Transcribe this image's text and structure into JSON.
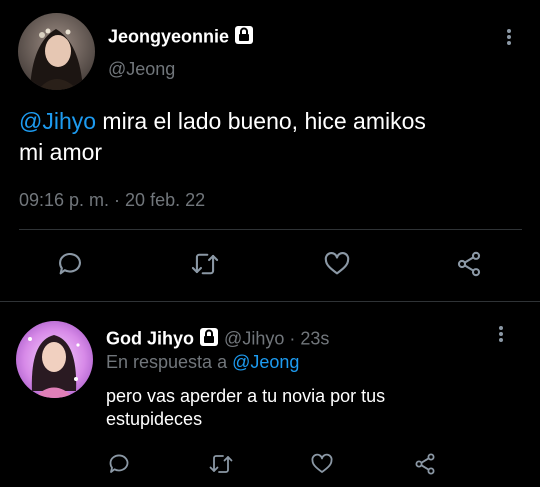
{
  "main_tweet": {
    "display_name": "Jeongyeonnie",
    "handle": "@Jeong",
    "mention": "@Jihyo",
    "text_line1": " mira el lado bueno, hice amikos",
    "text_line2": "mi amor",
    "timestamp": "09:16 p. m. · 20 feb. 22",
    "avatar_icon": "profile-photo"
  },
  "reply_tweet": {
    "display_name": "God Jihyo",
    "handle": "@Jihyo",
    "separator": "·",
    "time": "23s",
    "replying_prefix": "En respuesta a",
    "replying_to": "@Jeong",
    "text_line1": "pero vas aperder a tu novia por tus",
    "text_line2": "estupideces",
    "avatar_icon": "profile-photo"
  },
  "actions": [
    "reply-icon",
    "retweet-icon",
    "like-icon",
    "share-icon"
  ],
  "colors": {
    "background": "#000000",
    "text": "#e7e9ea",
    "muted": "#71767b",
    "link": "#1d9bf0",
    "divider": "#2f3336"
  }
}
